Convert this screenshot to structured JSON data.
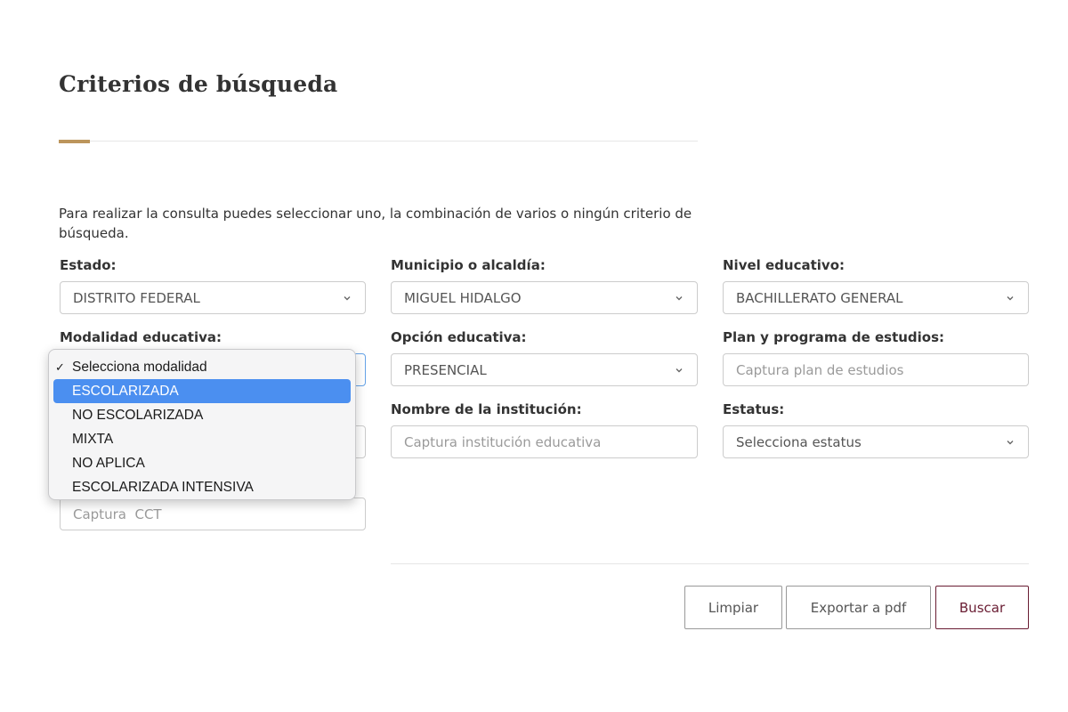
{
  "header": {
    "title": "Criterios de búsqueda",
    "accent_color": "#bc955c"
  },
  "intro_text": "Para realizar la consulta puedes seleccionar uno, la combinación de varios o ningún criterio de búsqueda.",
  "fields": {
    "estado": {
      "label": "Estado:",
      "value": "DISTRITO FEDERAL"
    },
    "municipio": {
      "label": "Municipio o alcaldía:",
      "value": "MIGUEL HIDALGO"
    },
    "nivel": {
      "label": "Nivel educativo:",
      "value": "BACHILLERATO GENERAL"
    },
    "modalidad": {
      "label": "Modalidad educativa:"
    },
    "opcion": {
      "label": "Opción educativa:",
      "value": "PRESENCIAL"
    },
    "plan": {
      "label": "Plan y programa de estudios:",
      "placeholder": "Captura plan de estudios"
    },
    "institucion": {
      "label": "Nombre de la institución:",
      "placeholder": "Captura institución educativa"
    },
    "estatus": {
      "label": "Estatus:",
      "value": "Selecciona estatus"
    },
    "cct": {
      "placeholder": "Captura  CCT"
    }
  },
  "modalidad_dropdown": {
    "checkmark": "✓",
    "selected_color": "#4b8ff0",
    "options": [
      "Selecciona modalidad",
      "ESCOLARIZADA",
      "NO ESCOLARIZADA",
      "MIXTA",
      "NO APLICA",
      "ESCOLARIZADA INTENSIVA"
    ]
  },
  "buttons": {
    "limpiar": "Limpiar",
    "exportar": "Exportar a pdf",
    "buscar": "Buscar",
    "buscar_color": "#691c32"
  },
  "icons": {
    "select_arrow": "chevron-down-icon",
    "option_check": "checkmark-icon"
  }
}
